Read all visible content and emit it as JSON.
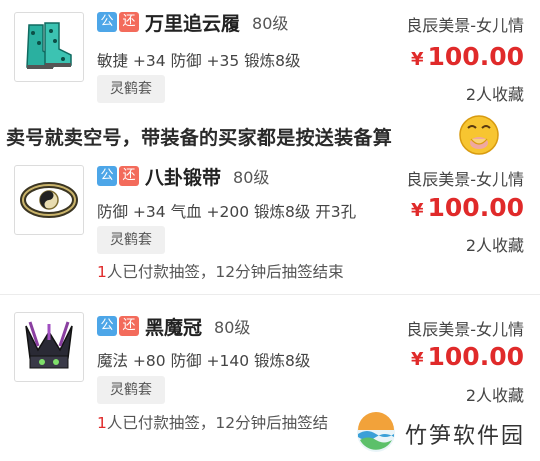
{
  "items": [
    {
      "badges": {
        "gong": "公",
        "huan": "还"
      },
      "name": "万里追云履",
      "level": "80级",
      "server": "良辰美景-女儿情",
      "attrs": "敏捷 +34 防御 +35 锻炼8级",
      "price_symbol": "¥",
      "price": "100.00",
      "favorites": "2人收藏",
      "tag": "灵鹤套",
      "icon": "boots-icon"
    },
    {
      "badges": {
        "gong": "公",
        "huan": "还"
      },
      "name": "八卦锻带",
      "level": "80级",
      "server": "良辰美景-女儿情",
      "attrs": "防御 +34 气血 +200 锻炼8级 开3孔",
      "price_symbol": "¥",
      "price": "100.00",
      "favorites": "2人收藏",
      "tag": "灵鹤套",
      "lottery_count": "1",
      "lottery_text": "人已付款抽签，12分钟后抽签结束",
      "icon": "belt-icon"
    },
    {
      "badges": {
        "gong": "公",
        "huan": "还"
      },
      "name": "黑魔冠",
      "level": "80级",
      "server": "良辰美景-女儿情",
      "attrs": "魔法 +80 防御 +140 锻炼8级",
      "price_symbol": "¥",
      "price": "100.00",
      "favorites": "2人收藏",
      "tag": "灵鹤套",
      "lottery_count": "1",
      "lottery_text": "人已付款抽签，12分钟后抽签结",
      "icon": "helmet-icon"
    }
  ],
  "overlay_caption": "卖号就卖空号，带装备的买家都是按送装备算",
  "watermark": "竹笋软件园",
  "colors": {
    "price": "#e02a2a",
    "badge_gong": "#4da6e8",
    "badge_huan": "#f36b5b"
  }
}
